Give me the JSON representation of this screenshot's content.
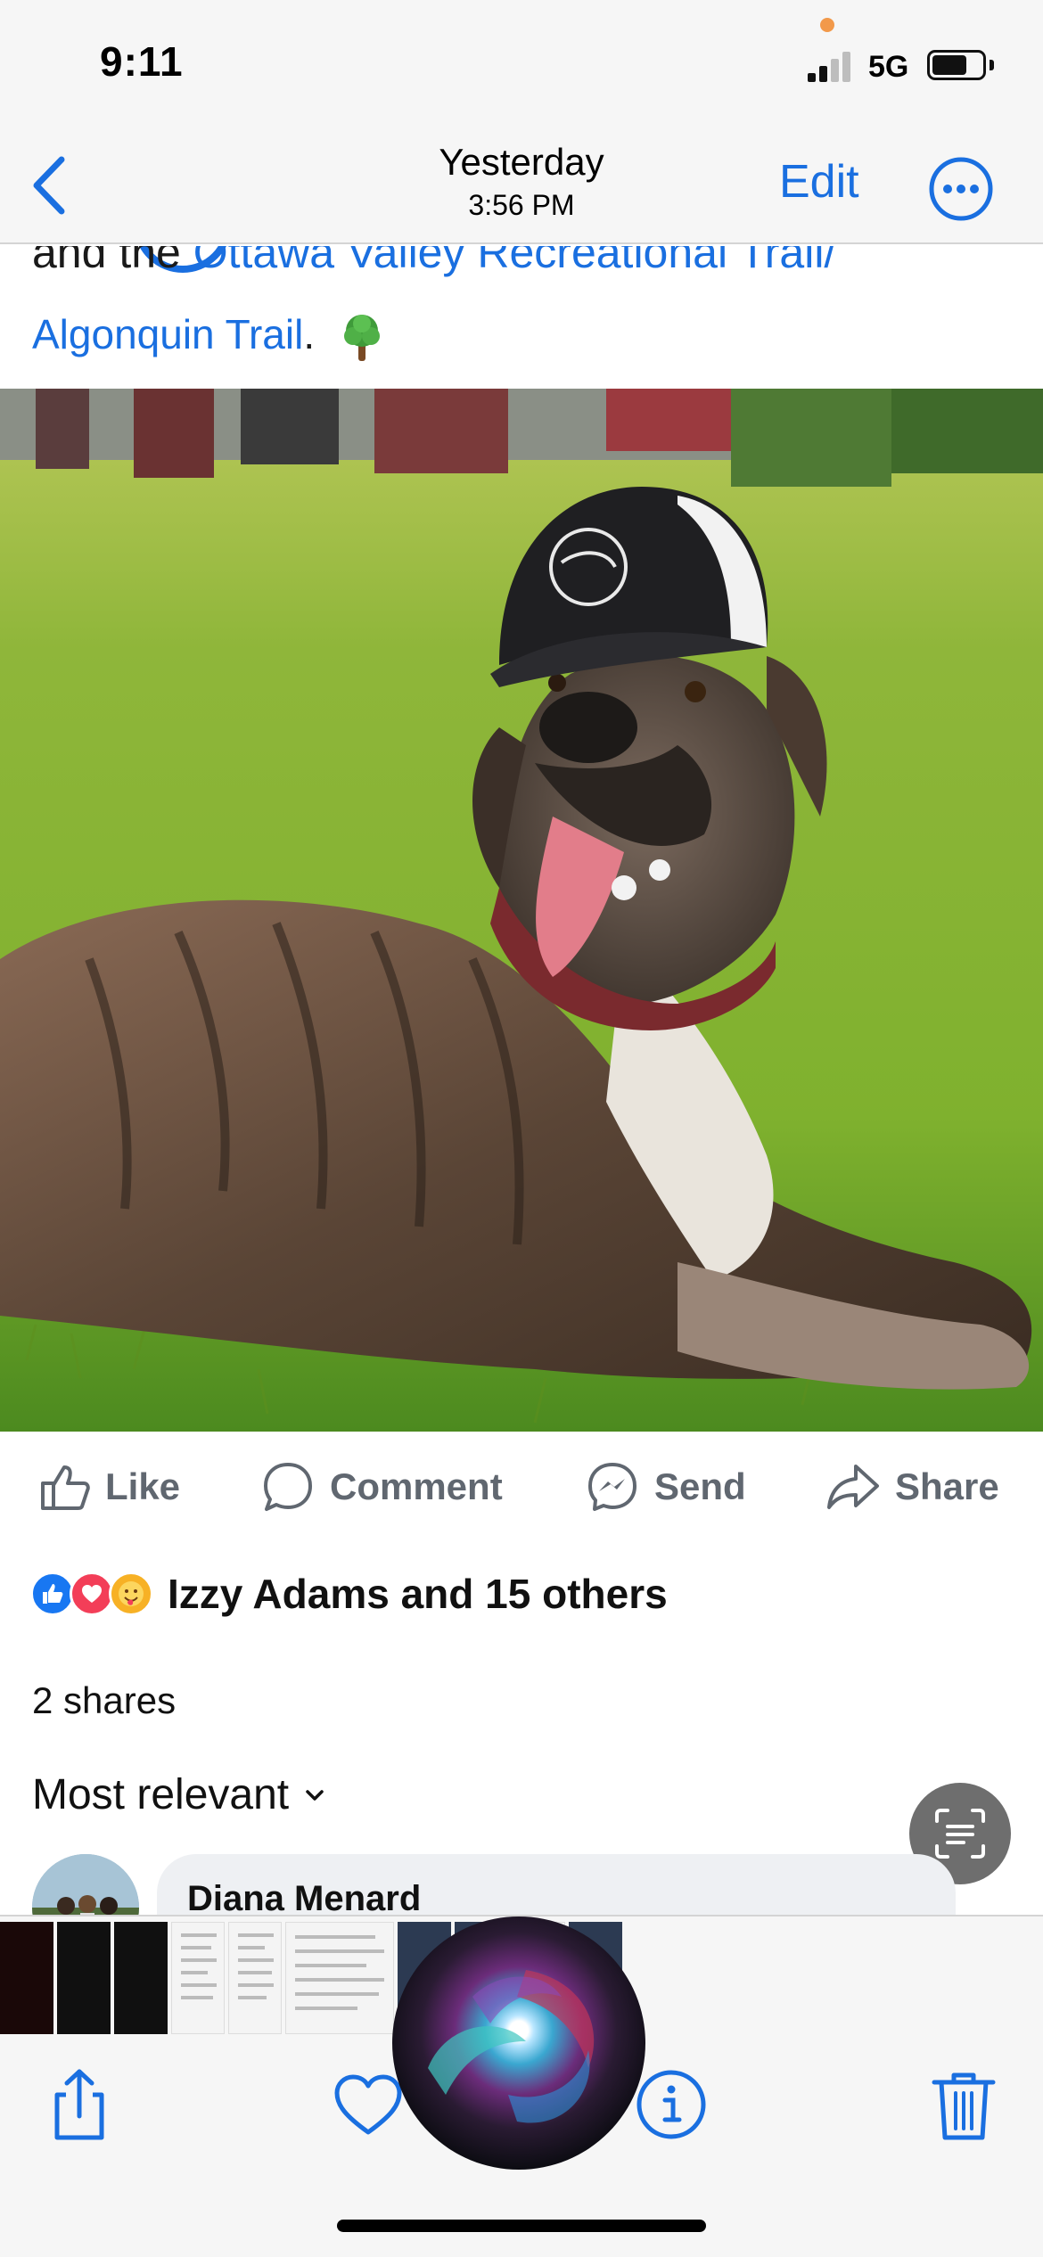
{
  "status_bar": {
    "time": "9:11",
    "network": "5G"
  },
  "nav": {
    "title": "Yesterday",
    "subtitle": "3:56 PM",
    "edit_label": "Edit"
  },
  "post": {
    "cut_prefix": "and the ",
    "cut_link": "Ottawa Valley Recreational Trail/",
    "line2_link": "Algonquin Trail",
    "line2_suffix": "."
  },
  "actions": {
    "like": "Like",
    "comment": "Comment",
    "send": "Send",
    "share": "Share"
  },
  "reactions": {
    "icons": [
      "like-reaction",
      "love-reaction",
      "care-reaction"
    ],
    "names": "Izzy Adams and 15 others"
  },
  "shares": "2 shares",
  "comments": {
    "sort_label": "Most relevant",
    "first_author": "Diana Menard"
  },
  "colors": {
    "accent": "#1a6fe0",
    "action_gray": "#606770",
    "like_blue": "#1877f2",
    "love_red": "#f33e58"
  }
}
